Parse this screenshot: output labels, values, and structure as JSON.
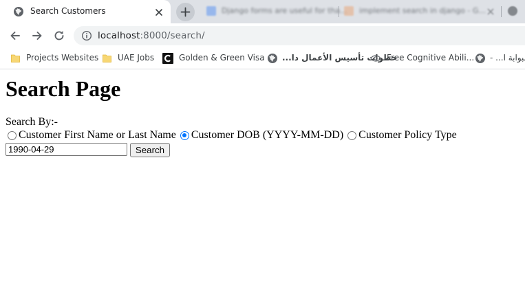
{
  "browser": {
    "active_tab": {
      "title": "Search Customers",
      "favicon": "globe-icon",
      "close_icon": "close-icon"
    },
    "new_tab_icon": "plus-icon",
    "background_tabs": [
      {
        "title": "Django forms are useful for tha...",
        "favicon_color": "#4285f4"
      },
      {
        "title": "implement search in django - G...",
        "favicon_color": "#e8a87c"
      },
      {
        "title": "",
        "favicon_color": "#5f6368"
      }
    ],
    "nav": {
      "back_icon": "arrow-left-icon",
      "forward_icon": "arrow-right-icon",
      "reload_icon": "reload-icon"
    },
    "address": {
      "info_icon": "info-icon",
      "host": "localhost",
      "rest": ":8000/search/"
    },
    "bookmarks": [
      {
        "label": "Projects Websites",
        "icon": "folder-icon"
      },
      {
        "label": "UAE Jobs",
        "icon": "folder-icon"
      },
      {
        "label": "Golden & Green Visa",
        "icon": "c-logo-icon"
      },
      {
        "label": "خطوات تأسيس الأعمال دا...",
        "icon": "globe-icon"
      },
      {
        "label": "Free Cognitive Abili...",
        "icon": "eye-icon"
      },
      {
        "label": "البوابة ا... -",
        "icon": "globe-icon"
      }
    ]
  },
  "page": {
    "heading": "Search Page",
    "search_by_label": "Search By:-",
    "options": [
      {
        "label": "Customer First Name or Last Name",
        "checked": false
      },
      {
        "label": "Customer DOB (YYYY-MM-DD)",
        "checked": true
      },
      {
        "label": "Customer Policy Type",
        "checked": false
      }
    ],
    "search_value": "1990-04-29",
    "search_button": "Search"
  },
  "colors": {
    "tabstrip": "#dee1e6",
    "omnibox": "#f1f3f4",
    "radio_accent": "#0075ff"
  }
}
